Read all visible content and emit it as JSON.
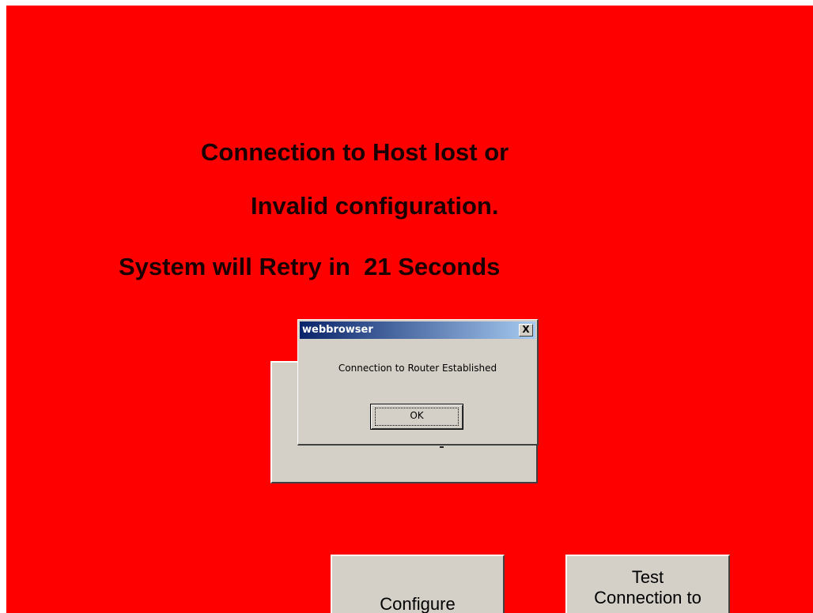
{
  "screen": {
    "background_color": "#ff0000",
    "status_line_1": "Connection to Host lost or",
    "status_line_2": "Invalid configuration.",
    "status_line_3": "System will Retry in  21 Seconds"
  },
  "message_box": {
    "title": "webbrowser",
    "close_label": "X",
    "message": "Connection to Router Established",
    "ok_label": "OK"
  },
  "buttons": {
    "configure_label": "Configure",
    "test_connection_label": "Test\nConnection to"
  }
}
